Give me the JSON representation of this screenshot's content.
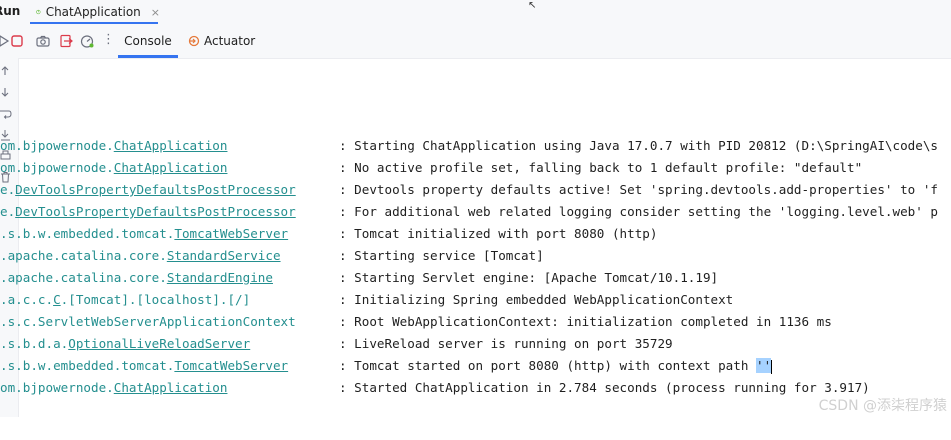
{
  "topbar": {
    "run_label": "Run",
    "tab_label": "ChatApplication",
    "close": "×"
  },
  "toolbar": {
    "console_label": "Console",
    "actuator_label": "Actuator",
    "more": "⋮"
  },
  "log": [
    {
      "pkg": "om.bjpowernode.",
      "cls": "ChatApplication",
      "msg": ": Starting ChatApplication using Java 17.0.7 with PID 20812 (D:\\SpringAI\\code\\s"
    },
    {
      "pkg": "om.bjpowernode.",
      "cls": "ChatApplication",
      "msg": ": No active profile set, falling back to 1 default profile: \"default\""
    },
    {
      "pkg": "e.",
      "cls": "DevToolsPropertyDefaultsPostProcessor",
      "msg": ": Devtools property defaults active! Set 'spring.devtools.add-properties' to 'f"
    },
    {
      "pkg": "e.",
      "cls": "DevToolsPropertyDefaultsPostProcessor",
      "msg": ": For additional web related logging consider setting the 'logging.level.web' p"
    },
    {
      "pkg": ".s.b.w.embedded.tomcat.",
      "cls": "TomcatWebServer",
      "msg": ": Tomcat initialized with port 8080 (http)"
    },
    {
      "pkg": ".apache.catalina.core.",
      "cls": "StandardService",
      "msg": ": Starting service [Tomcat]"
    },
    {
      "pkg": ".apache.catalina.core.",
      "cls": "StandardEngine",
      "msg": ": Starting Servlet engine: [Apache Tomcat/10.1.19]"
    },
    {
      "pkg": ".a.c.c.",
      "cls": "C",
      "tail": ".[Tomcat].[localhost].[/]",
      "msg": ": Initializing Spring embedded WebApplicationContext"
    },
    {
      "pkg": ".s.c.",
      "cls": "ServletWebServerApplicationContext",
      "msg": ": Root WebApplicationContext: initialization completed in 1136 ms"
    },
    {
      "pkg": ".s.b.d.a.",
      "cls": "OptionalLiveReloadServer",
      "msg": ": LiveReload server is running on port 35729"
    },
    {
      "pkg": ".s.b.w.embedded.tomcat.",
      "cls": "TomcatWebServer",
      "msg": ": Tomcat started on port 8080 (http) with context path ",
      "sel": "''"
    },
    {
      "pkg": "om.bjpowernode.",
      "cls": "ChatApplication",
      "msg": ": Started ChatApplication in 2.784 seconds (process running for 3.917)"
    }
  ],
  "watermark": "CSDN @添柒程序猿",
  "colors": {
    "logger": "#248f8f",
    "accent": "#3574f0",
    "selection": "#a6d2ff"
  }
}
